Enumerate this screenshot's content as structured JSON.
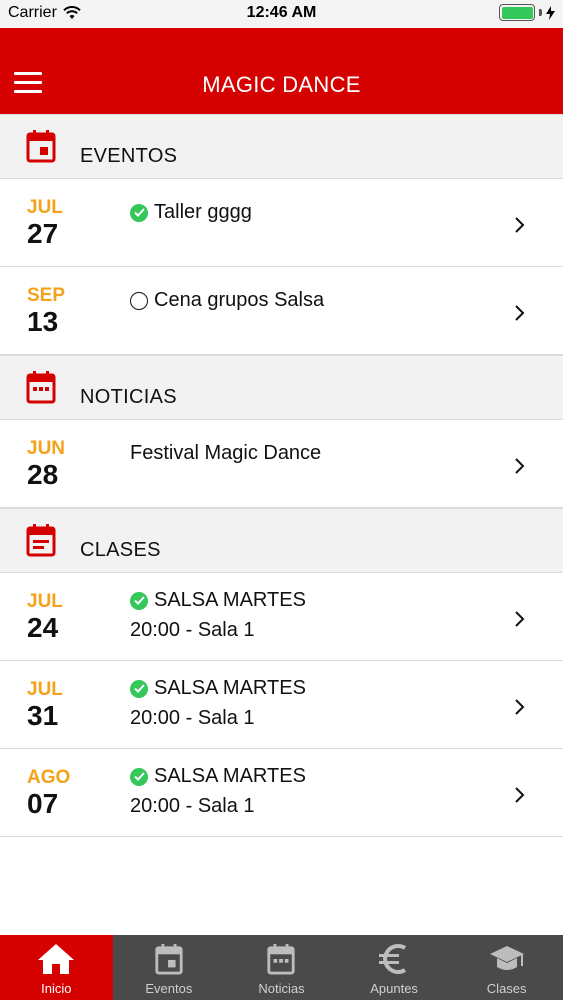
{
  "status_bar": {
    "carrier": "Carrier",
    "time": "12:46 AM",
    "battery_level": 1.0
  },
  "nav": {
    "title": "MAGIC DANCE"
  },
  "sections": {
    "eventos": {
      "title": "EVENTOS",
      "rows": [
        {
          "month": "JUL",
          "day": "27",
          "title": "Taller gggg",
          "status": "confirmed"
        },
        {
          "month": "SEP",
          "day": "13",
          "title": "Cena grupos Salsa",
          "status": "pending"
        }
      ]
    },
    "noticias": {
      "title": "NOTICIAS",
      "rows": [
        {
          "month": "JUN",
          "day": "28",
          "title": "Festival Magic Dance"
        }
      ]
    },
    "clases": {
      "title": "CLASES",
      "rows": [
        {
          "month": "JUL",
          "day": "24",
          "title": "SALSA MARTES",
          "detail": "20:00 - Sala 1",
          "status": "confirmed"
        },
        {
          "month": "JUL",
          "day": "31",
          "title": "SALSA MARTES",
          "detail": "20:00 - Sala 1",
          "status": "confirmed"
        },
        {
          "month": "AGO",
          "day": "07",
          "title": "SALSA MARTES",
          "detail": "20:00 - Sala 1",
          "status": "confirmed"
        }
      ]
    }
  },
  "tabs": [
    {
      "label": "Inicio",
      "icon": "home-icon",
      "active": true
    },
    {
      "label": "Eventos",
      "icon": "calendar-icon",
      "active": false
    },
    {
      "label": "Noticias",
      "icon": "calendar-dots-icon",
      "active": false
    },
    {
      "label": "Apuntes",
      "icon": "euro-icon",
      "active": false
    },
    {
      "label": "Clases",
      "icon": "graduation-cap-icon",
      "active": false
    }
  ],
  "colors": {
    "brand": "#d50000",
    "month": "#f4a21b",
    "check": "#34c759",
    "tabbar": "#4a4a4a"
  }
}
